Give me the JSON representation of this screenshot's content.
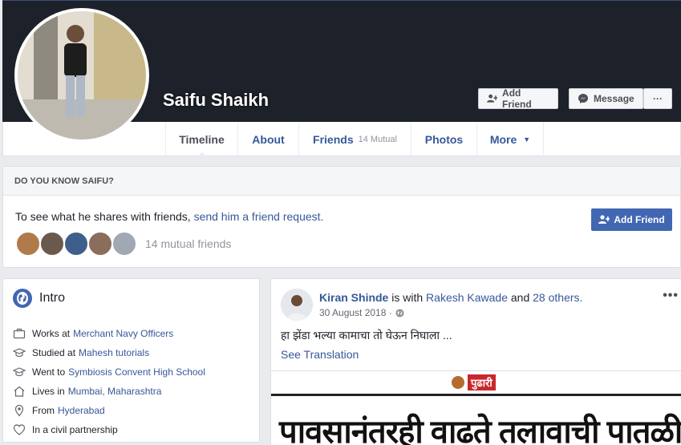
{
  "profile": {
    "name": "Saifu Shaikh"
  },
  "cover_buttons": {
    "add_friend": "Add Friend",
    "message": "Message",
    "more": "···"
  },
  "tabs": [
    {
      "label": "Timeline",
      "sub": ""
    },
    {
      "label": "About",
      "sub": ""
    },
    {
      "label": "Friends",
      "sub": "14 Mutual"
    },
    {
      "label": "Photos",
      "sub": ""
    },
    {
      "label": "More",
      "sub": "▼"
    }
  ],
  "know": {
    "title": "DO YOU KNOW SAIFU?",
    "text": "To see what he shares with friends,",
    "link": "send him a friend request.",
    "button": "Add Friend",
    "mutual": "14 mutual friends",
    "mutual_colors": [
      "#b07a4a",
      "#6a5a4e",
      "#3e5f8a",
      "#8a6d5a",
      "#9fa8b3"
    ]
  },
  "intro": {
    "title": "Intro",
    "items": [
      {
        "icon": "briefcase-icon",
        "prefix": "Works at",
        "link": "Merchant Navy Officers"
      },
      {
        "icon": "graduation-cap-icon",
        "prefix": "Studied at",
        "link": "Mahesh tutorials"
      },
      {
        "icon": "graduation-cap-icon",
        "prefix": "Went to",
        "link": "Symbiosis Convent High School"
      },
      {
        "icon": "home-icon",
        "prefix": "Lives in",
        "link": "Mumbai, Maharashtra"
      },
      {
        "icon": "location-pin-icon",
        "prefix": "From",
        "link": "Hyderabad"
      },
      {
        "icon": "heart-icon",
        "prefix": "In a civil partnership",
        "link": ""
      }
    ]
  },
  "post": {
    "author": "Kiran Shinde",
    "is_with": "is with",
    "with_name": "Rakesh Kawade",
    "and": "and",
    "others": "28 others.",
    "date": "30 August 2018 ·",
    "text": "हा झेंडा भल्या कामाचा तो घेऊन निघाला ...",
    "see_translation": "See Translation",
    "paper_name": "पुढारी",
    "headline": "पावसानंतरही वाढते तलावाची पातळी",
    "more": "•••"
  },
  "colors": {
    "brand": "#4267b2",
    "link": "#365899",
    "cover": "#1d2129"
  }
}
